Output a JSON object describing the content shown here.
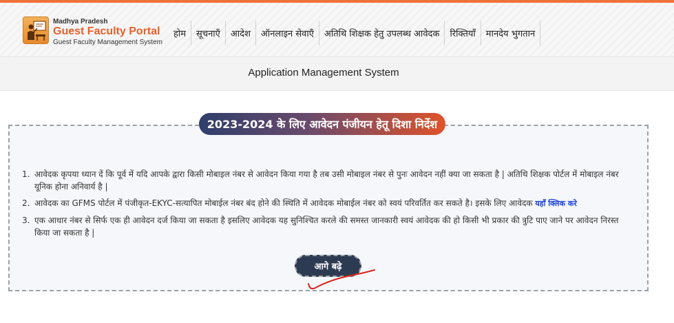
{
  "brand": {
    "top": "Madhya Pradesh",
    "main": "Guest Faculty Portal",
    "sub": "Guest Faculty Management System",
    "logo_icon": "teacher-board-icon"
  },
  "nav": [
    {
      "label": "होम"
    },
    {
      "label": "सूचनाएँ"
    },
    {
      "label": "आदेश"
    },
    {
      "label": "ऑनलाइन सेवाएँ"
    },
    {
      "label": "अतिथि शिक्षक हेतु उपलब्ध आवेदक"
    },
    {
      "label": "रिक्तियाँ"
    },
    {
      "label": "मानदेय भुगतान"
    }
  ],
  "subheader": {
    "title": "Application Management System"
  },
  "guide": {
    "title": "2023-2024 के लिए आवेदन पंजीयन हेतू दिशा निर्देश",
    "items": [
      {
        "num": "1.",
        "text": "आवेदक कृपया ध्यान दें कि पूर्व में यदि आपके द्वारा किसी मोबाइल नंबर से आवेदन किया गया है तब उसी मोबाइल नंबर से पुनः आवेदन नहीं क्या जा सकता है | अतिथि शिक्षक पोर्टल में मोबाइल नंबर यूनिक होना अनिवार्य है |"
      },
      {
        "num": "2.",
        "text": "आवेदक का GFMS पोर्टल में पंजीकृत-EKYC-सत्यापित मोबाईल नंबर बंद होने की स्थिति में आवेदक मोबाईल नंबर को स्वयं परिवर्तित कर सकते है। इसके लिए आवेदक ",
        "link": "यहाँ क्लिक करे"
      },
      {
        "num": "3.",
        "text": "एक आधार नंबर से सिर्फ एक ही आवेदन दर्ज किया जा सकता है इसलिए आवेदक यह सुनिश्चित करले की समस्त जानकारी स्वयं आवेदक की हो किसी भी प्रकार की त्रुटि पाए जाने पर आवेदन निरस्त किया जा सकता है |"
      }
    ],
    "next_button": "आगे बढ़े"
  },
  "colors": {
    "accent": "#e8602b",
    "button": "#2d3b52",
    "link": "#1a3fd8",
    "annotation": "#d9261c"
  }
}
